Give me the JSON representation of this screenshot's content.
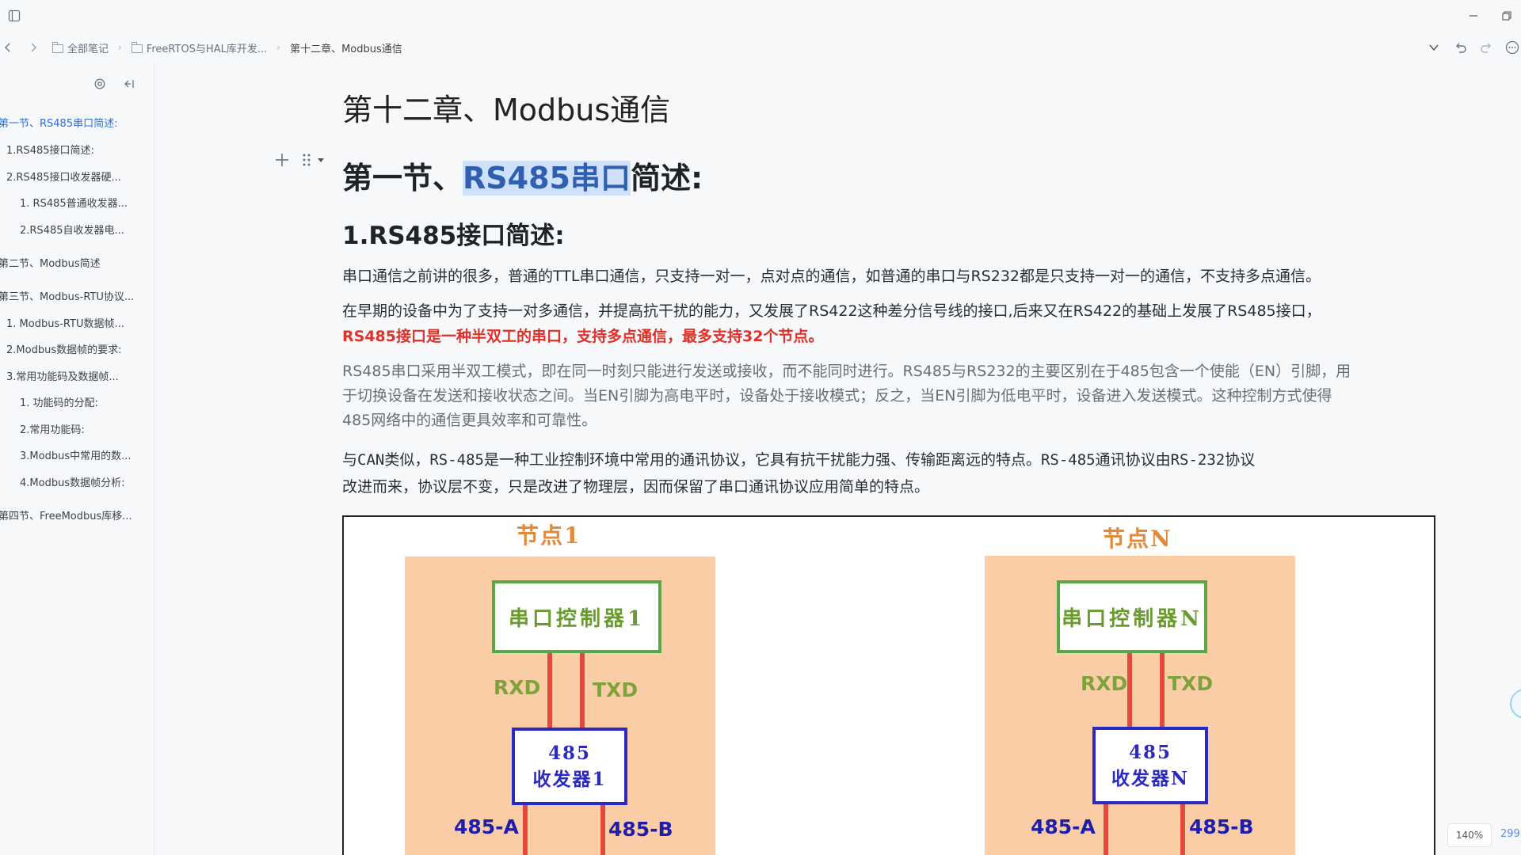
{
  "breadcrumb": {
    "items": [
      "全部笔记",
      "FreeRTOS与HAL库开发...",
      "第十二章、Modbus通信"
    ]
  },
  "sidebar": {
    "toc": [
      {
        "label": "第一节、RS485串口简述:",
        "level": 0,
        "active": true
      },
      {
        "label": "1.RS485接口简述:",
        "level": 1,
        "active": false
      },
      {
        "label": "2.RS485接口收发器硬...",
        "level": 1,
        "active": false
      },
      {
        "label": "1. RS485普通收发器...",
        "level": 2,
        "active": false
      },
      {
        "label": "2.RS485自收发器电...",
        "level": 2,
        "active": false
      },
      {
        "label": "第二节、Modbus简述",
        "level": 0,
        "active": false
      },
      {
        "label": "第三节、Modbus-RTU协议...",
        "level": 0,
        "active": false
      },
      {
        "label": "1. Modbus-RTU数据帧...",
        "level": 1,
        "active": false
      },
      {
        "label": "2.Modbus数据帧的要求:",
        "level": 1,
        "active": false
      },
      {
        "label": "3.常用功能码及数据帧...",
        "level": 1,
        "active": false
      },
      {
        "label": "1. 功能码的分配:",
        "level": 2,
        "active": false
      },
      {
        "label": "2.常用功能码:",
        "level": 2,
        "active": false
      },
      {
        "label": "3.Modbus中常用的数...",
        "level": 2,
        "active": false
      },
      {
        "label": "4.Modbus数据帧分析:",
        "level": 2,
        "active": false
      },
      {
        "label": "第四节、FreeModbus库移...",
        "level": 0,
        "active": false
      }
    ]
  },
  "doc": {
    "title": "第十二章、Modbus通信",
    "h1_prefix": "第一节、",
    "h1_highlight": "RS485串口",
    "h1_suffix": "简述:",
    "h2": "1.RS485接口简述:",
    "p1": "串口通信之前讲的很多，普通的TTL串口通信，只支持一对一，点对点的通信，如普通的串口与RS232都是只支持一对一的通信，不支持多点通信。",
    "p2_line1": "在早期的设备中为了支持一对多通信，并提高抗干扰的能力，又发展了RS422这种差分信号线的接口,后来又在RS422的基础上发展了RS485接口，",
    "p2_red": "RS485接口是一种半双工的串口，支持多点通信，最多支持32个节点。",
    "p3_line1": "RS485串口采用半双工模式，即在同一时刻只能进行发送或接收，而不能同时进行。RS485与RS232的主要区别在于485包含一个使能（EN）引脚，用",
    "p3_line2": "于切换设备在发送和接收状态之间。当EN引脚为高电平时，设备处于接收模式；反之，当EN引脚为低电平时，设备进入发送模式。这种控制方式使得",
    "p3_line3": "485网络中的通信更具效率和可靠性。",
    "p4_line1": "与CAN类似，RS-485是一种工业控制环境中常用的通讯协议，它具有抗干扰能力强、传输距离远的特点。RS-485通讯协议由RS-232协议",
    "p4_line2": "改进而来，协议层不变，只是改进了物理层，因而保留了串口通讯协议应用简单的特点。"
  },
  "figure": {
    "node1": {
      "title": "节点1",
      "controller": "串口控制器1",
      "rxd": "RXD",
      "txd": "TXD",
      "xcvr_line1": "485",
      "xcvr_line2": "收发器1",
      "bus_a": "485-A",
      "bus_b": "485-B"
    },
    "nodeN": {
      "title": "节点N",
      "controller": "串口控制器N",
      "rxd": "RXD",
      "txd": "TXD",
      "xcvr_line1": "485",
      "xcvr_line2": "收发器N",
      "bus_a": "485-A",
      "bus_b": "485-B"
    }
  },
  "status": {
    "zoom": "140%",
    "wordcount": "299"
  }
}
